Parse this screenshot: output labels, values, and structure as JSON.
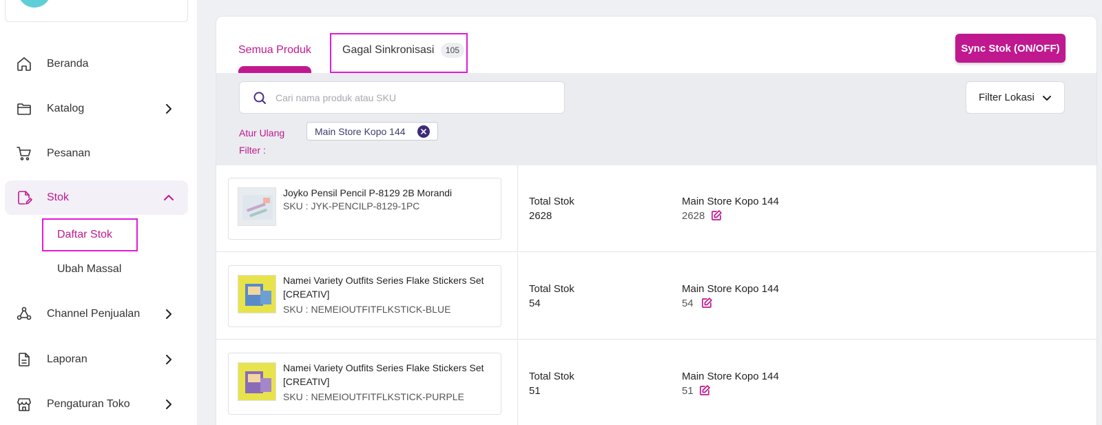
{
  "sidebar": {
    "items": [
      {
        "label": "Beranda",
        "icon": "home-icon"
      },
      {
        "label": "Katalog",
        "icon": "folder-icon"
      },
      {
        "label": "Pesanan",
        "icon": "cart-icon"
      },
      {
        "label": "Stok",
        "icon": "box-edit-icon"
      },
      {
        "label": "Channel Penjualan",
        "icon": "channel-icon"
      },
      {
        "label": "Laporan",
        "icon": "document-icon"
      },
      {
        "label": "Pengaturan Toko",
        "icon": "store-icon"
      }
    ],
    "sub_items": [
      {
        "label": "Daftar Stok"
      },
      {
        "label": "Ubah Massal"
      }
    ]
  },
  "tabs": {
    "all_label": "Semua Produk",
    "failed_label": "Gagal Sinkronisasi",
    "failed_count": "105"
  },
  "sync_button": "Sync Stok (ON/OFF)",
  "search": {
    "placeholder": "Cari nama produk atau SKU"
  },
  "location_filter": "Filter Lokasi",
  "reset_filter": "Atur Ulang Filter :",
  "chip": "Main Store Kopo 144",
  "products": [
    {
      "name": "Joyko Pensil Pencil P-8129 2B Morandi",
      "sku": "SKU : JYK-PENCILP-8129-1PC",
      "total_label": "Total Stok",
      "total": "2628",
      "location": "Main Store Kopo 144",
      "location_stock": "2628"
    },
    {
      "name": "Namei Variety Outfits Series Flake Stickers Set [CREATIV]",
      "sku": "SKU : NEMEIOUTFITFLKSTICK-BLUE",
      "total_label": "Total Stok",
      "total": "54",
      "location": "Main Store Kopo 144",
      "location_stock": "54"
    },
    {
      "name": "Namei Variety Outfits Series Flake Stickers Set [CREATIV]",
      "sku": "SKU : NEMEIOUTFITFLKSTICK-PURPLE",
      "total_label": "Total Stok",
      "total": "51",
      "location": "Main Store Kopo 144",
      "location_stock": "51"
    }
  ],
  "colors": {
    "accent": "#c0188f",
    "highlight": "#e319d8",
    "filter_bg": "#eaecf0"
  }
}
